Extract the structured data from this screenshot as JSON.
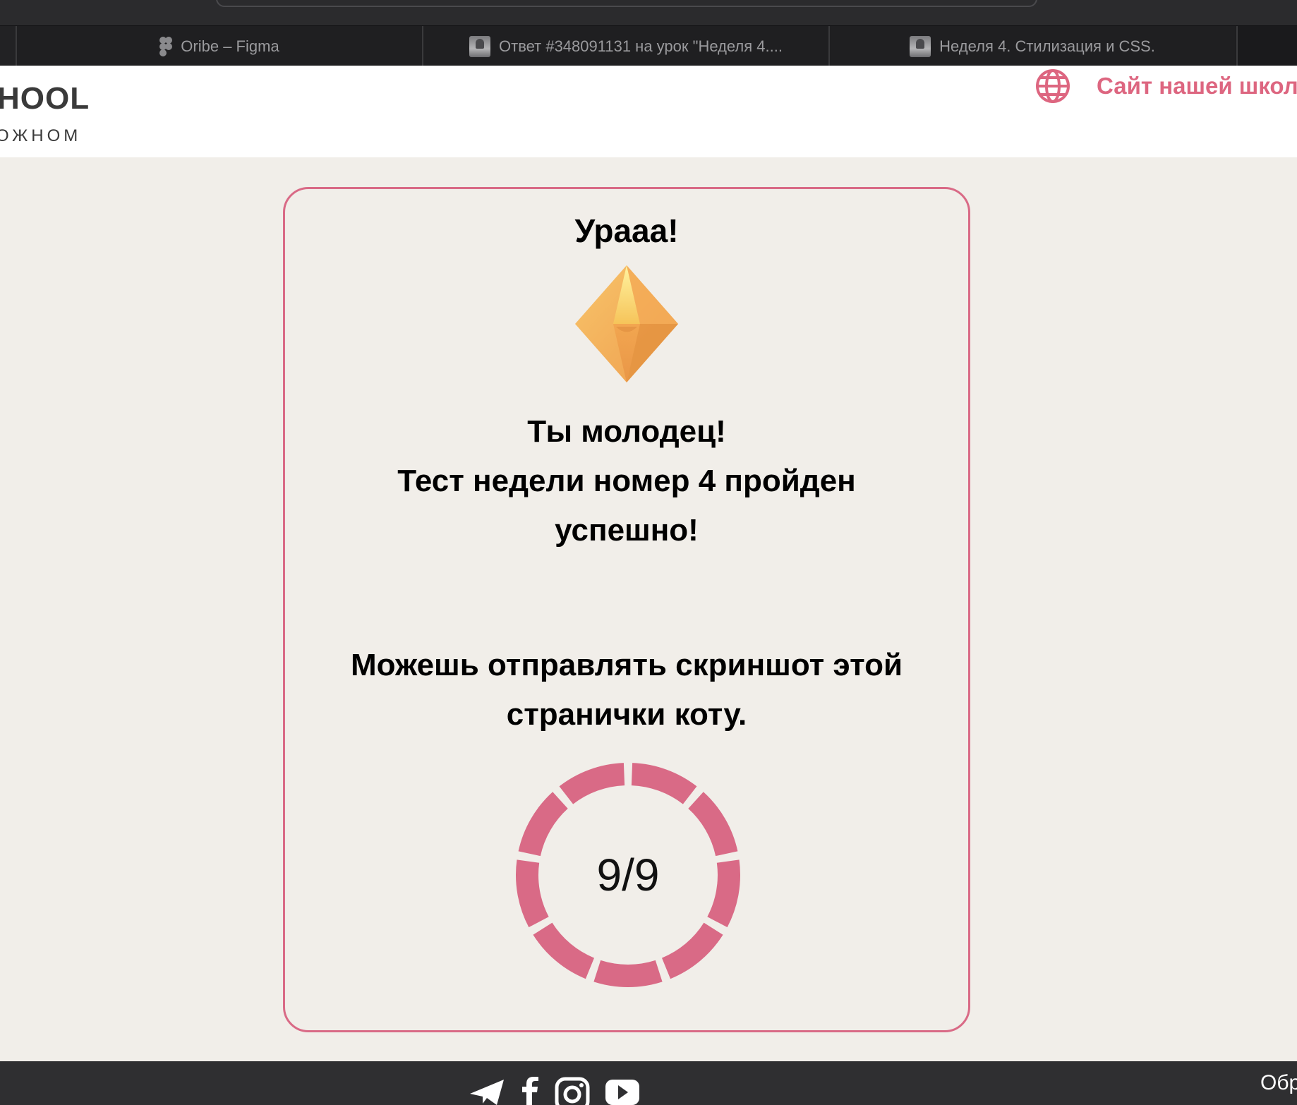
{
  "browser": {
    "tabs": [
      {
        "label": "Oribe – Figma",
        "icon": "figma-icon"
      },
      {
        "label": "Ответ #348091131 на урок \"Неделя 4....",
        "icon": "site-favicon"
      },
      {
        "label": "Неделя 4. Стилизация и CSS.",
        "icon": "site-favicon"
      }
    ]
  },
  "header": {
    "logo_main": "HOOL",
    "logo_sub": "ОЖНОМ",
    "site_link": "Сайт нашей школы",
    "site_link_icon": "globe-icon"
  },
  "card": {
    "title": "Ураaa!",
    "icon": "diamond-gem-icon",
    "message_lines": [
      "Ты молодец!",
      "Тест недели номер 4 пройден",
      "успешно!"
    ],
    "instruction_lines": [
      "Можешь отправлять скриншот этой",
      "странички коту."
    ],
    "score_text": "9/9",
    "score_correct": 9,
    "score_total": 9
  },
  "footer": {
    "social_icons": [
      "telegram-icon",
      "facebook-icon",
      "instagram-icon",
      "youtube-icon"
    ],
    "right_text": "Обр"
  },
  "colors": {
    "accent": "#d96a86",
    "page_bg": "#f1eee9",
    "tab_bar": "#1d1d1f",
    "footer_bg": "#2f2f31"
  }
}
